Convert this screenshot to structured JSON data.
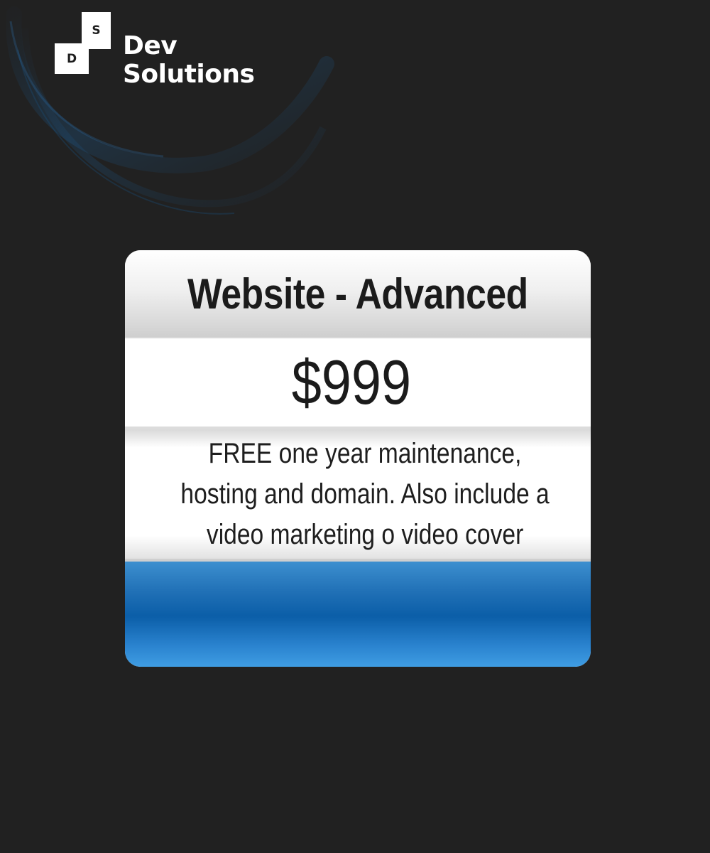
{
  "brand": {
    "mark_top_letter": "S",
    "mark_bottom_letter": "D",
    "name_line1": "Dev",
    "name_line2": "Solutions"
  },
  "card": {
    "title": "Website - Advanced",
    "price": "$999",
    "description": "FREE one year maintenance, hosting and domain. Also include a video marketing o video cover"
  },
  "colors": {
    "background": "#212121",
    "accent_blue": "#0b5ea8",
    "text_dark": "#1b1b1b",
    "logo_white": "#ffffff"
  }
}
